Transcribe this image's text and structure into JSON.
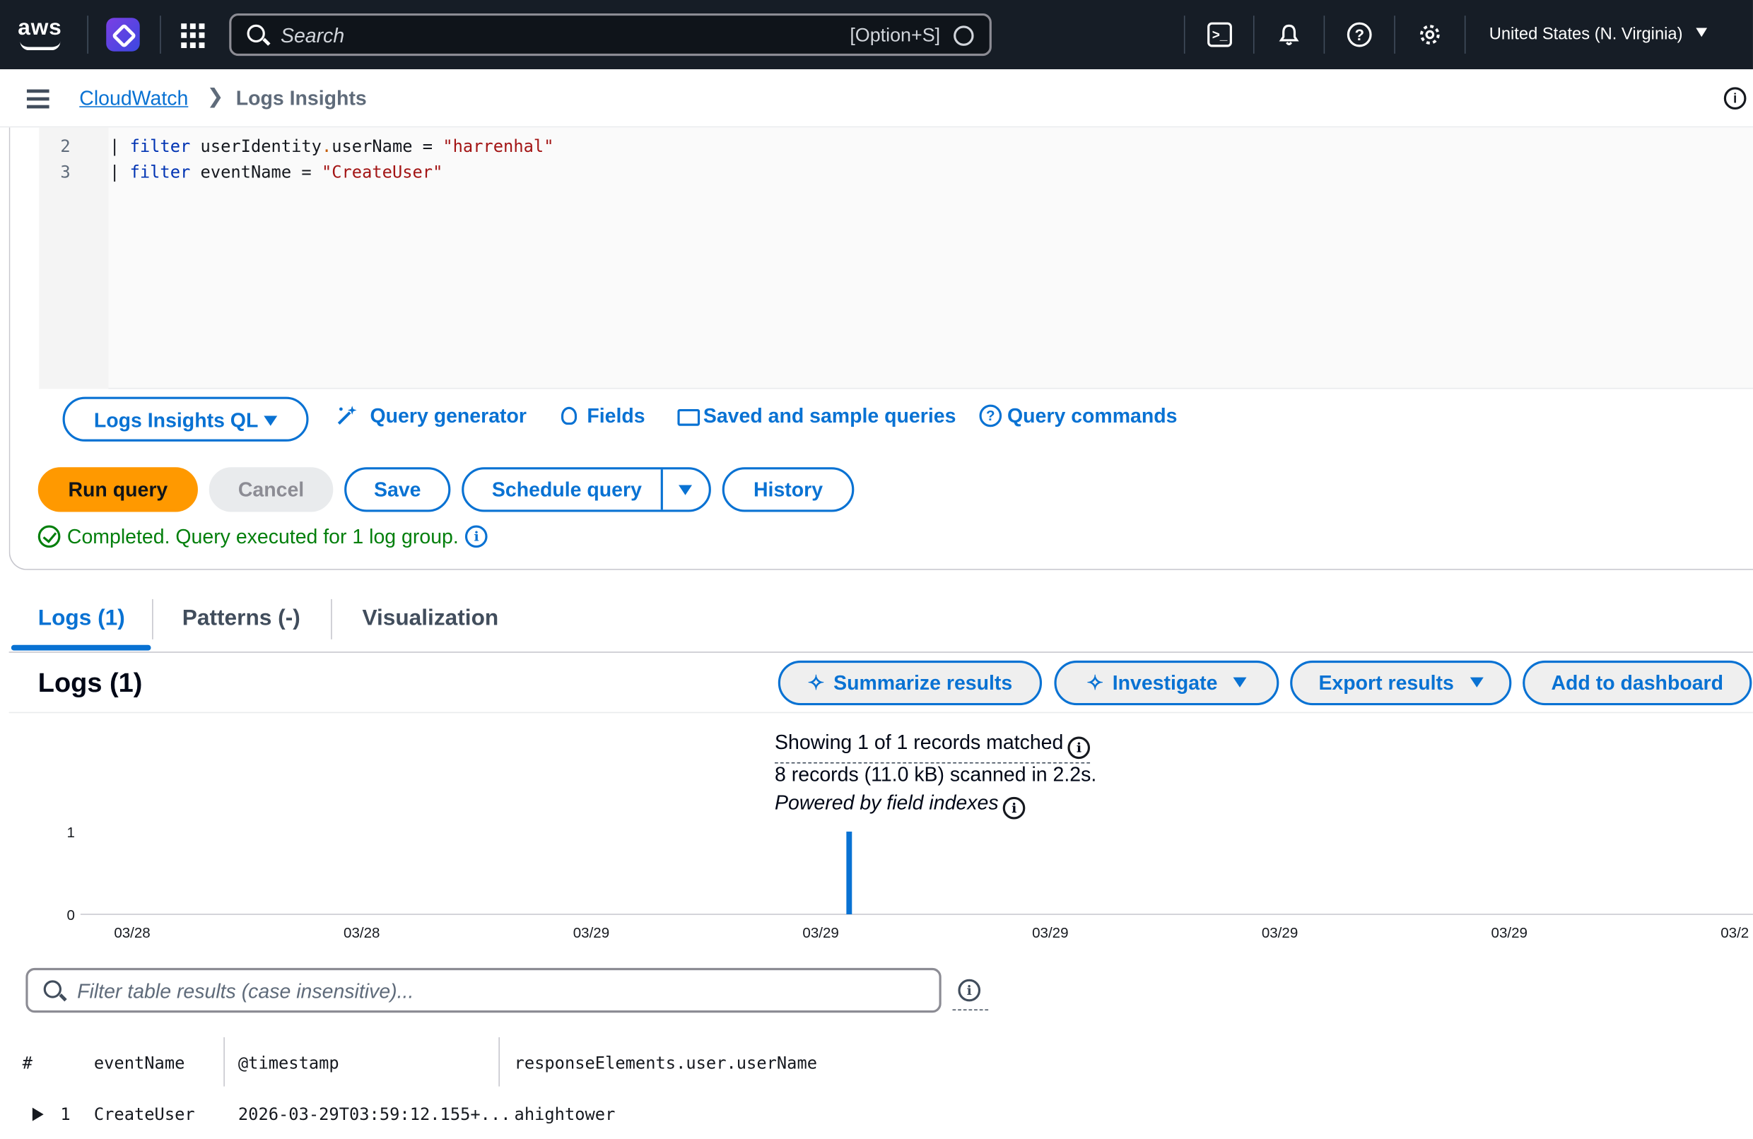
{
  "topbar": {
    "logo": "aws",
    "search_placeholder": "Search",
    "search_shortcut": "[Option+S]",
    "region": "United States (N. Virginia)",
    "icons": [
      "cloudshell-icon",
      "bell-icon",
      "help-icon",
      "settings-icon"
    ]
  },
  "breadcrumb": {
    "parent": "CloudWatch",
    "current": "Logs Insights"
  },
  "editor": {
    "lines": [
      {
        "num": "2",
        "pipe": "| ",
        "kw": "filter",
        "field_a": " userIdentity",
        "dot": ".",
        "field_b": "userName",
        "op": " = ",
        "str": "\"harrenhal\""
      },
      {
        "num": "3",
        "pipe": "| ",
        "kw": "filter",
        "field_a": " eventName",
        "op": " = ",
        "str": "\"CreateUser\""
      }
    ]
  },
  "toolbar": {
    "language": "Logs Insights QL",
    "query_generator": "Query generator",
    "fields": "Fields",
    "saved_queries": "Saved and sample queries",
    "query_commands": "Query commands"
  },
  "actions": {
    "run": "Run query",
    "cancel": "Cancel",
    "save": "Save",
    "schedule": "Schedule query",
    "history": "History"
  },
  "status": "Completed. Query executed for 1 log group.",
  "tabs": [
    "Logs (1)",
    "Patterns (-)",
    "Visualization"
  ],
  "logs": {
    "title": "Logs (1)",
    "summarize": "Summarize results",
    "investigate": "Investigate",
    "export": "Export results",
    "add_dashboard": "Add to dashboard",
    "summary_matched": "Showing 1 of 1 records matched",
    "summary_scanned": "8 records (11.0 kB) scanned in 2.2s.",
    "summary_indexes": "Powered by field indexes"
  },
  "chart_data": {
    "type": "bar",
    "x_tick_labels": [
      "03/28",
      "03/28",
      "03/29",
      "03/29",
      "03/29",
      "03/29",
      "03/29",
      "03/2"
    ],
    "y_ticks": [
      0,
      1
    ],
    "ylim": [
      0,
      1
    ],
    "bars": [
      {
        "position_fraction": 0.4596,
        "value": 1
      }
    ],
    "bar_color": "#0972d3"
  },
  "filter": {
    "placeholder": "Filter table results (case insensitive)..."
  },
  "table": {
    "columns": [
      "#",
      "eventName",
      "@timestamp",
      "responseElements.user.userName"
    ],
    "rows": [
      {
        "index": "1",
        "eventName": "CreateUser",
        "timestamp": "2026-03-29T03:59:12.155+...",
        "userName": "ahightower"
      }
    ]
  }
}
